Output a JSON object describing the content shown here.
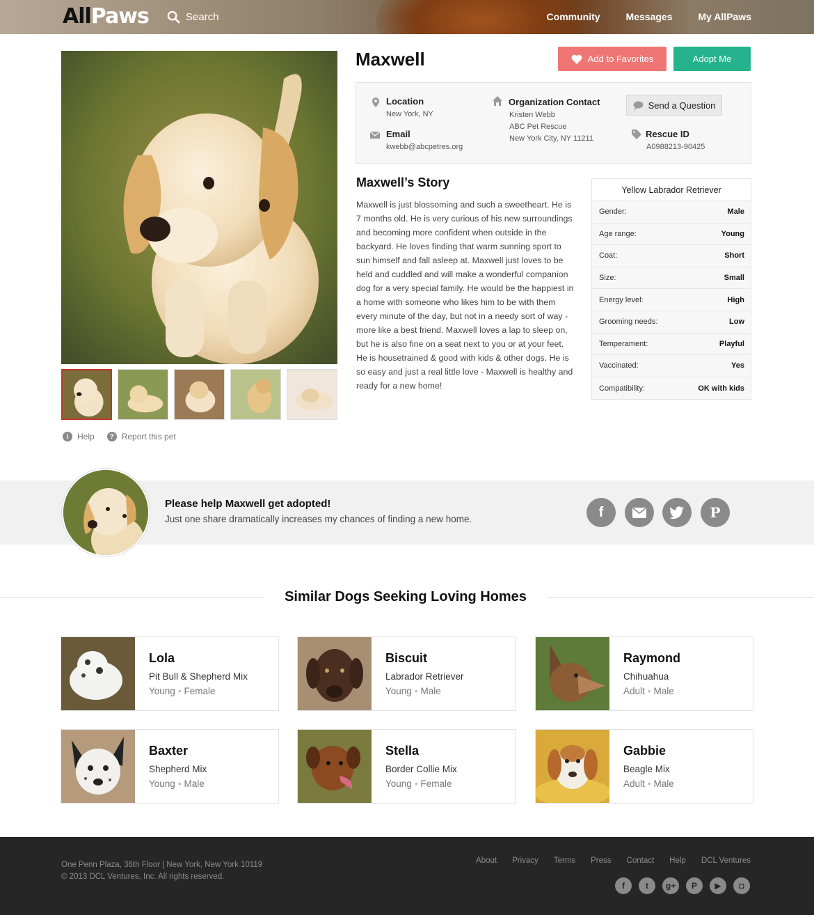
{
  "header": {
    "logo_all": "All",
    "logo_paws": "Paws",
    "search_label": "Search",
    "nav": [
      "Community",
      "Messages",
      "My AllPaws"
    ]
  },
  "pet": {
    "name": "Maxwell",
    "add_favorites_label": "Add to Favorites",
    "adopt_label": "Adopt Me",
    "help_label": "Help",
    "report_label": "Report this pet"
  },
  "contact": {
    "location_label": "Location",
    "location_value": "New York, NY",
    "email_label": "Email",
    "email_value": "kwebb@abcpetres.org",
    "org_label": "Organization Contact",
    "org_lines": [
      "Kristen Webb",
      "ABC Pet Rescue",
      "New York City, NY 11211"
    ],
    "send_question_label": "Send a Question",
    "rescue_id_label": "Rescue ID",
    "rescue_id_value": "A0988213-90425"
  },
  "story": {
    "title": "Maxwell’s Story",
    "text": "Maxwell is just blossoming and such a sweetheart. He is 7 months old. He is very curious of his new surroundings and becoming more confident when outside in the backyard. He loves finding that warm sunning sport to sun himself and fall asleep at. Maxwell just loves to be held and cuddled and will make a wonderful companion dog for a very special family. He would be the happiest in a home with someone who likes him to be with them every minute of the day, but not in a needy sort of way - more like a best friend. Maxwell loves a lap to sleep on, but he is also fine on a seat next to you or at your feet. He is housetrained & good with kids & other dogs. He is so easy and just a real little love - Maxwell is healthy and ready for a new home!"
  },
  "attributes": {
    "breed": "Yellow Labrador Retriever",
    "rows": [
      {
        "key": "Gender:",
        "value": "Male"
      },
      {
        "key": "Age range:",
        "value": "Young"
      },
      {
        "key": "Coat:",
        "value": "Short"
      },
      {
        "key": "Size:",
        "value": "Small"
      },
      {
        "key": "Energy level:",
        "value": "High"
      },
      {
        "key": "Grooming needs:",
        "value": "Low"
      },
      {
        "key": "Temperament:",
        "value": "Playful"
      },
      {
        "key": "Vaccinated:",
        "value": "Yes"
      },
      {
        "key": "Compatibility:",
        "value": "OK with kids"
      }
    ]
  },
  "share": {
    "title": "Please help Maxwell get adopted!",
    "subtitle": "Just one share dramatically increases my chances of finding a new home.",
    "icons": [
      "facebook-icon",
      "email-icon",
      "twitter-icon",
      "pinterest-icon"
    ]
  },
  "similar": {
    "title": "Similar Dogs Seeking Loving Homes",
    "dogs": [
      {
        "name": "Lola",
        "breed": "Pit Bull & Shepherd Mix",
        "age": "Young",
        "gender": "Female"
      },
      {
        "name": "Biscuit",
        "breed": "Labrador Retriever",
        "age": "Young",
        "gender": "Male"
      },
      {
        "name": "Raymond",
        "breed": "Chihuahua",
        "age": "Adult",
        "gender": "Male"
      },
      {
        "name": "Baxter",
        "breed": "Shepherd Mix",
        "age": "Young",
        "gender": "Male"
      },
      {
        "name": "Stella",
        "breed": "Border Collie Mix",
        "age": "Young",
        "gender": "Female"
      },
      {
        "name": "Gabbie",
        "breed": "Beagle Mix",
        "age": "Adult",
        "gender": "Male"
      }
    ]
  },
  "footer": {
    "address": "One Penn Plaza, 36th Floor | New York, New York 10119",
    "copyright": "© 2013 DCL Ventures, Inc. All rights reserved.",
    "links": [
      "About",
      "Privacy",
      "Terms",
      "Press",
      "Contact",
      "Help",
      "DCL Ventures"
    ],
    "social_icons": [
      "facebook-icon",
      "twitter-icon",
      "google-plus-icon",
      "pinterest-icon",
      "youtube-icon",
      "instagram-icon"
    ]
  },
  "colors": {
    "favorites": "#ef7674",
    "adopt": "#24b38c",
    "footer_bg": "#262626"
  }
}
